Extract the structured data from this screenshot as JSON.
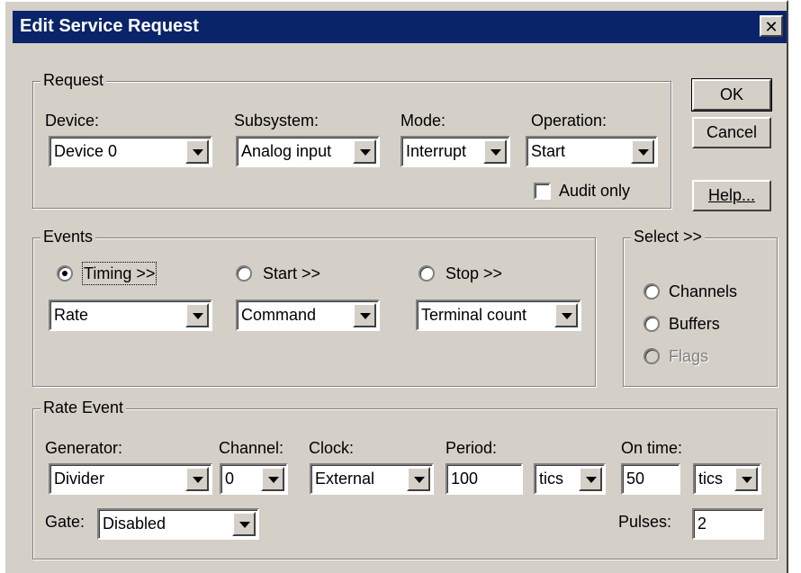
{
  "window": {
    "title": "Edit Service Request",
    "close_glyph": "✕"
  },
  "buttons": {
    "ok": "OK",
    "cancel": "Cancel",
    "help": "Help..."
  },
  "request": {
    "group_label": "Request",
    "device_label": "Device:",
    "device_value": "Device 0",
    "subsystem_label": "Subsystem:",
    "subsystem_value": "Analog input",
    "mode_label": "Mode:",
    "mode_value": "Interrupt",
    "operation_label": "Operation:",
    "operation_value": "Start",
    "audit_only_label": "Audit only",
    "audit_only_checked": false
  },
  "events": {
    "group_label": "Events",
    "timing_label": "Timing >>",
    "timing_selected": true,
    "timing_value": "Rate",
    "start_label": "Start >>",
    "start_selected": false,
    "start_value": "Command",
    "stop_label": "Stop >>",
    "stop_selected": false,
    "stop_value": "Terminal count"
  },
  "select": {
    "group_label": "Select >>",
    "channels_label": "Channels",
    "buffers_label": "Buffers",
    "flags_label": "Flags",
    "flags_enabled": false
  },
  "rate_event": {
    "group_label": "Rate Event",
    "generator_label": "Generator:",
    "generator_value": "Divider",
    "channel_label": "Channel:",
    "channel_value": "0",
    "clock_label": "Clock:",
    "clock_value": "External",
    "period_label": "Period:",
    "period_value": "100",
    "period_unit": "tics",
    "on_time_label": "On time:",
    "on_time_value": "50",
    "on_time_unit": "tics",
    "gate_label": "Gate:",
    "gate_value": "Disabled",
    "pulses_label": "Pulses:",
    "pulses_value": "2"
  },
  "colors": {
    "titlebar": "#0a246a",
    "face": "#d4d0c8"
  },
  "icons": {
    "dropdown": "chevron-down-icon",
    "close": "close-icon"
  }
}
